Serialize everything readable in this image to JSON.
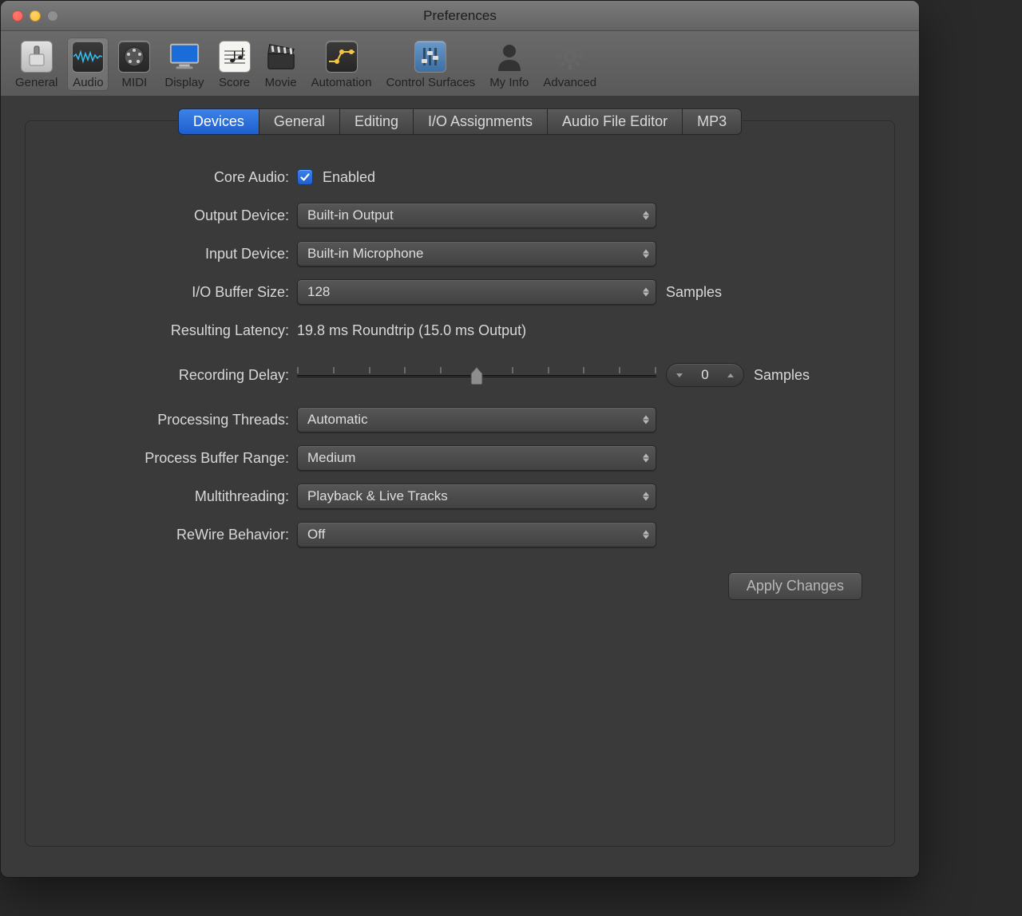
{
  "window": {
    "title": "Preferences"
  },
  "toolbar": {
    "items": [
      {
        "label": "General"
      },
      {
        "label": "Audio"
      },
      {
        "label": "MIDI"
      },
      {
        "label": "Display"
      },
      {
        "label": "Score"
      },
      {
        "label": "Movie"
      },
      {
        "label": "Automation"
      },
      {
        "label": "Control Surfaces"
      },
      {
        "label": "My Info"
      },
      {
        "label": "Advanced"
      }
    ],
    "active": 1
  },
  "subtabs": {
    "items": [
      "Devices",
      "General",
      "Editing",
      "I/O Assignments",
      "Audio File Editor",
      "MP3"
    ],
    "active": 0
  },
  "form": {
    "core_audio": {
      "label": "Core Audio:",
      "checkbox_label": "Enabled",
      "checked": true
    },
    "output_device": {
      "label": "Output Device:",
      "value": "Built-in Output"
    },
    "input_device": {
      "label": "Input Device:",
      "value": "Built-in Microphone"
    },
    "io_buffer": {
      "label": "I/O Buffer Size:",
      "value": "128",
      "suffix": "Samples"
    },
    "latency": {
      "label": "Resulting Latency:",
      "value": "19.8 ms Roundtrip (15.0 ms Output)"
    },
    "recording_delay": {
      "label": "Recording Delay:",
      "value": "0",
      "suffix": "Samples"
    },
    "processing_threads": {
      "label": "Processing Threads:",
      "value": "Automatic"
    },
    "process_buffer_range": {
      "label": "Process Buffer Range:",
      "value": "Medium"
    },
    "multithreading": {
      "label": "Multithreading:",
      "value": "Playback & Live Tracks"
    },
    "rewire": {
      "label": "ReWire Behavior:",
      "value": "Off"
    }
  },
  "buttons": {
    "apply": "Apply Changes"
  }
}
